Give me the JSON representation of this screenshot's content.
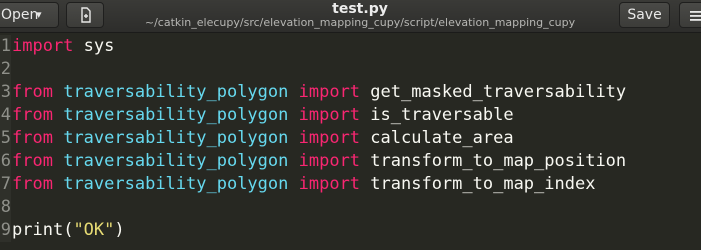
{
  "header": {
    "open_label": "Open",
    "open_chevron": "▾",
    "title": "test.py",
    "path": "~/catkin_elecupy/src/elevation_mapping_cupy/script/elevation_mapping_cupy",
    "save_label": "Save"
  },
  "editor": {
    "lines": [
      {
        "num": "1",
        "t": [
          {
            "c": "kw",
            "v": "import"
          },
          {
            "c": "plain",
            "v": " sys"
          }
        ]
      },
      {
        "num": "2",
        "t": []
      },
      {
        "num": "3",
        "t": [
          {
            "c": "kw",
            "v": "from"
          },
          {
            "c": "plain",
            "v": " "
          },
          {
            "c": "mod",
            "v": "traversability_polygon"
          },
          {
            "c": "plain",
            "v": " "
          },
          {
            "c": "kw",
            "v": "import"
          },
          {
            "c": "plain",
            "v": " get_masked_traversability"
          }
        ]
      },
      {
        "num": "4",
        "t": [
          {
            "c": "kw",
            "v": "from"
          },
          {
            "c": "plain",
            "v": " "
          },
          {
            "c": "mod",
            "v": "traversability_polygon"
          },
          {
            "c": "plain",
            "v": " "
          },
          {
            "c": "kw",
            "v": "import"
          },
          {
            "c": "plain",
            "v": " is_traversable"
          }
        ]
      },
      {
        "num": "5",
        "t": [
          {
            "c": "kw",
            "v": "from"
          },
          {
            "c": "plain",
            "v": " "
          },
          {
            "c": "mod",
            "v": "traversability_polygon"
          },
          {
            "c": "plain",
            "v": " "
          },
          {
            "c": "kw",
            "v": "import"
          },
          {
            "c": "plain",
            "v": " calculate_area"
          }
        ]
      },
      {
        "num": "6",
        "t": [
          {
            "c": "kw",
            "v": "from"
          },
          {
            "c": "plain",
            "v": " "
          },
          {
            "c": "mod",
            "v": "traversability_polygon"
          },
          {
            "c": "plain",
            "v": " "
          },
          {
            "c": "kw",
            "v": "import"
          },
          {
            "c": "plain",
            "v": " transform_to_map_position"
          }
        ]
      },
      {
        "num": "7",
        "t": [
          {
            "c": "kw",
            "v": "from"
          },
          {
            "c": "plain",
            "v": " "
          },
          {
            "c": "mod",
            "v": "traversability_polygon"
          },
          {
            "c": "plain",
            "v": " "
          },
          {
            "c": "kw",
            "v": "import"
          },
          {
            "c": "plain",
            "v": " transform_to_map_index"
          }
        ]
      },
      {
        "num": "8",
        "t": []
      },
      {
        "num": "9",
        "t": [
          {
            "c": "pl",
            "v": "print"
          },
          {
            "c": "pn",
            "v": "("
          },
          {
            "c": "str",
            "v": "\"OK\""
          },
          {
            "c": "pn",
            "v": ")"
          }
        ]
      }
    ]
  },
  "colors": {
    "background": "#272822",
    "keyword": "#f92672",
    "module": "#66d9ef",
    "string": "#e6db74",
    "text": "#f8f8f2"
  }
}
